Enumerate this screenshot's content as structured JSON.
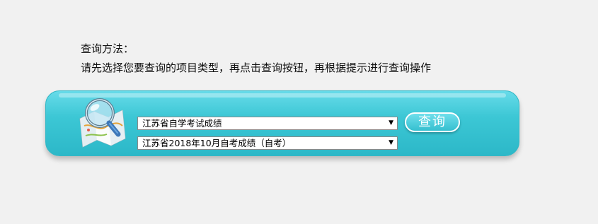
{
  "instructions": {
    "heading": "查询方法：",
    "body": "请先选择您要查询的项目类型，再点击查询按钮，再根据提示进行查询操作"
  },
  "query": {
    "exam_select": {
      "value": "江苏省自学考试成绩",
      "arrow": "▼"
    },
    "session_select": {
      "value": "江苏省2018年10月自考成绩（自考）",
      "arrow": "▼"
    },
    "search_button_label": "查询",
    "icon": "map-magnifier-icon"
  },
  "colors": {
    "page_background": "#f1f1f1",
    "panel_top": "#67dbe9",
    "panel_bottom": "#2cb8c8",
    "button_text": "#ffffff"
  }
}
